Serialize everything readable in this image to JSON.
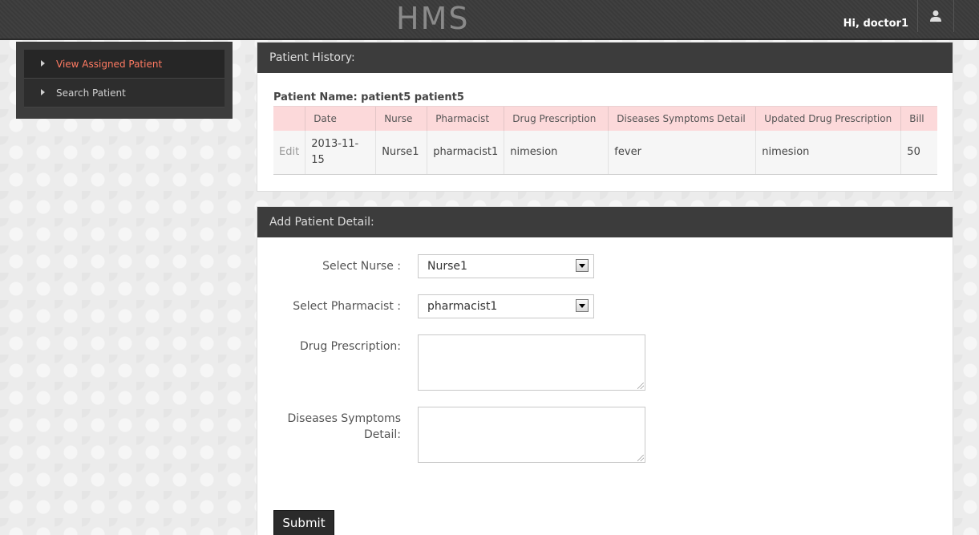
{
  "header": {
    "brand": "HMS",
    "greeting": "Hi, doctor1",
    "user_icon": "user-icon"
  },
  "sidebar": {
    "items": [
      {
        "label": "View Assigned Patient",
        "active": true
      },
      {
        "label": "Search Patient",
        "active": false
      }
    ]
  },
  "history": {
    "title": "Patient History:",
    "patient_name": "Patient Name: patient5 patient5",
    "columns": [
      "",
      "Date",
      "Nurse",
      "Pharmacist",
      "Drug Prescription",
      "Diseases Symptoms Detail",
      "Updated Drug Prescription",
      "Bill"
    ],
    "rows": [
      {
        "edit": "Edit",
        "date": "2013-11-15",
        "nurse": "Nurse1",
        "pharmacist": "pharmacist1",
        "drug_prescription": "nimesion",
        "symptoms": "fever",
        "updated_drug": "nimesion",
        "bill": "50"
      }
    ]
  },
  "add_detail": {
    "title": "Add Patient Detail:",
    "nurse_label": "Select Nurse :",
    "nurse_value": "Nurse1",
    "pharmacist_label": "Select Pharmacist :",
    "pharmacist_value": "pharmacist1",
    "drug_label": "Drug Prescription:",
    "symptoms_label_line1": "Diseases Symptoms",
    "symptoms_label_line2": "Detail:",
    "submit_label": "Submit"
  },
  "colors": {
    "accent": "#ff7a62",
    "header_bg": "#3c3c3c",
    "table_header_bg": "#fcd9da"
  }
}
